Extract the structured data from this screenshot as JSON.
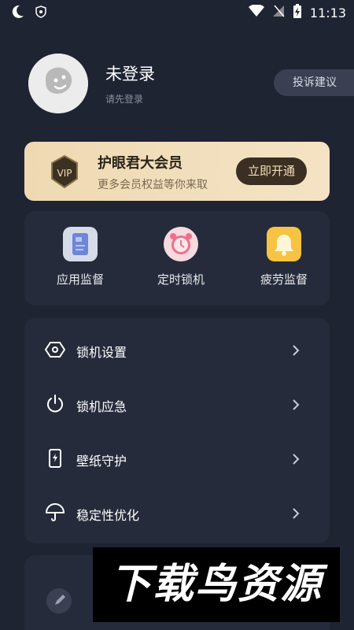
{
  "status_bar": {
    "time": "11:13"
  },
  "profile": {
    "username": "未登录",
    "subtitle": "请先登录",
    "feedback_label": "投诉建议"
  },
  "vip": {
    "title": "护眼君大会员",
    "subtitle": "更多会员权益等你来取",
    "button_label": "立即开通",
    "badge_text": "VIP"
  },
  "quick_actions": [
    {
      "label": "应用监督",
      "icon": "app-monitor-icon"
    },
    {
      "label": "定时锁机",
      "icon": "alarm-clock-icon"
    },
    {
      "label": "疲劳监督",
      "icon": "bell-icon"
    }
  ],
  "settings": [
    {
      "label": "锁机设置",
      "icon": "hexagon-settings-icon"
    },
    {
      "label": "锁机应急",
      "icon": "power-icon"
    },
    {
      "label": "壁纸守护",
      "icon": "phone-bolt-icon"
    },
    {
      "label": "稳定性优化",
      "icon": "umbrella-icon"
    }
  ],
  "watermark": "下载鸟资源"
}
